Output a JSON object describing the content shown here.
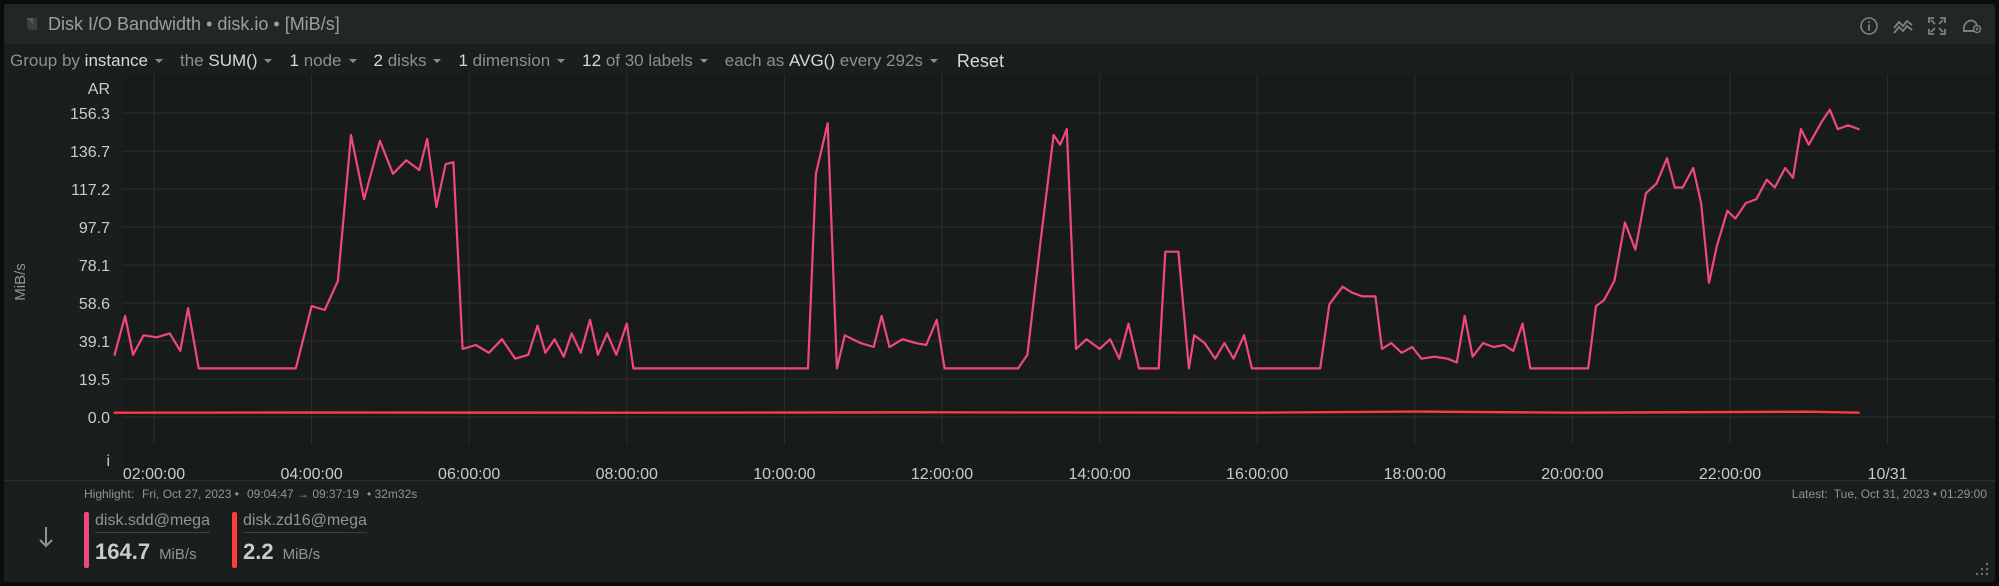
{
  "header": {
    "title": "Disk I/O Bandwidth • disk.io • [MiB/s]",
    "icons": [
      "info-icon",
      "correlate-icon",
      "fullscreen-icon",
      "alert-icon"
    ]
  },
  "filters": {
    "group_by_label": "Group by",
    "group_by_value": "instance",
    "the_label": "the",
    "aggregation": "SUM()",
    "nodes_count": "1",
    "nodes_label": "node",
    "disks_count": "2",
    "disks_label": "disks",
    "dimensions_count": "1",
    "dimensions_label": "dimension",
    "labels_count": "12",
    "labels_label": "of 30 labels",
    "each_as_label": "each as",
    "time_agg": "AVG()",
    "every_label": "every 292s",
    "reset_label": "Reset"
  },
  "chart": {
    "ar_label": "AR",
    "i_label": "i",
    "ylabel": "MiB/s",
    "yticks": [
      "156.3",
      "136.7",
      "117.2",
      "97.7",
      "78.1",
      "58.6",
      "39.1",
      "19.5",
      "0.0"
    ],
    "xticks": [
      "02:00:00",
      "04:00:00",
      "06:00:00",
      "08:00:00",
      "10:00:00",
      "12:00:00",
      "14:00:00",
      "16:00:00",
      "18:00:00",
      "20:00:00",
      "22:00:00",
      "10/31"
    ]
  },
  "chart_data": {
    "type": "line",
    "ylabel": "MiB/s",
    "ylim": [
      0,
      175.8
    ],
    "x_start": "01:30",
    "x_end": "11:29",
    "grid": true,
    "series": [
      {
        "name": "disk.sdd@mega",
        "color": "#f0487a",
        "points": [
          [
            "01:30",
            32
          ],
          [
            "01:38",
            52
          ],
          [
            "01:44",
            32
          ],
          [
            "01:52",
            42
          ],
          [
            "02:02",
            41
          ],
          [
            "02:12",
            43
          ],
          [
            "02:20",
            34
          ],
          [
            "02:26",
            56
          ],
          [
            "02:34",
            25
          ],
          [
            "02:50",
            25
          ],
          [
            "03:10",
            25
          ],
          [
            "03:30",
            25
          ],
          [
            "03:48",
            25
          ],
          [
            "04:00",
            57
          ],
          [
            "04:10",
            55
          ],
          [
            "04:20",
            70
          ],
          [
            "04:30",
            145
          ],
          [
            "04:40",
            112
          ],
          [
            "04:52",
            142
          ],
          [
            "05:02",
            125
          ],
          [
            "05:12",
            132
          ],
          [
            "05:22",
            127
          ],
          [
            "05:28",
            143
          ],
          [
            "05:35",
            108
          ],
          [
            "05:42",
            130
          ],
          [
            "05:48",
            131
          ],
          [
            "05:55",
            35
          ],
          [
            "06:05",
            37
          ],
          [
            "06:15",
            33
          ],
          [
            "06:25",
            40
          ],
          [
            "06:35",
            30
          ],
          [
            "06:45",
            32
          ],
          [
            "06:52",
            47
          ],
          [
            "06:58",
            33
          ],
          [
            "07:05",
            40
          ],
          [
            "07:12",
            31
          ],
          [
            "07:18",
            43
          ],
          [
            "07:25",
            33
          ],
          [
            "07:32",
            50
          ],
          [
            "07:38",
            32
          ],
          [
            "07:45",
            43
          ],
          [
            "07:52",
            32
          ],
          [
            "08:00",
            48
          ],
          [
            "08:05",
            25
          ],
          [
            "08:20",
            25
          ],
          [
            "08:40",
            25
          ],
          [
            "09:00",
            25
          ],
          [
            "09:20",
            25
          ],
          [
            "09:40",
            25
          ],
          [
            "10:00",
            25
          ],
          [
            "10:18",
            25
          ],
          [
            "10:24",
            125
          ],
          [
            "10:33",
            151
          ],
          [
            "10:40",
            25
          ],
          [
            "10:46",
            42
          ],
          [
            "10:58",
            38
          ],
          [
            "11:08",
            36
          ],
          [
            "11:14",
            52
          ],
          [
            "11:20",
            36
          ],
          [
            "11:30",
            40
          ],
          [
            "11:40",
            38
          ],
          [
            "11:48",
            37
          ],
          [
            "11:56",
            50
          ],
          [
            "12:02",
            25
          ],
          [
            "12:20",
            25
          ],
          [
            "12:40",
            25
          ],
          [
            "12:58",
            25
          ],
          [
            "13:05",
            32
          ],
          [
            "13:15",
            90
          ],
          [
            "13:25",
            145
          ],
          [
            "13:30",
            140
          ],
          [
            "13:35",
            148
          ],
          [
            "13:42",
            35
          ],
          [
            "13:50",
            40
          ],
          [
            "14:00",
            35
          ],
          [
            "14:08",
            40
          ],
          [
            "14:15",
            30
          ],
          [
            "14:22",
            48
          ],
          [
            "14:30",
            25
          ],
          [
            "14:45",
            25
          ],
          [
            "14:50",
            85
          ],
          [
            "15:00",
            85
          ],
          [
            "15:08",
            25
          ],
          [
            "15:12",
            42
          ],
          [
            "15:20",
            38
          ],
          [
            "15:28",
            30
          ],
          [
            "15:35",
            38
          ],
          [
            "15:42",
            30
          ],
          [
            "15:50",
            42
          ],
          [
            "15:56",
            25
          ],
          [
            "16:10",
            25
          ],
          [
            "16:30",
            25
          ],
          [
            "16:48",
            25
          ],
          [
            "16:55",
            58
          ],
          [
            "17:05",
            67
          ],
          [
            "17:12",
            64
          ],
          [
            "17:20",
            62
          ],
          [
            "17:30",
            62
          ],
          [
            "17:35",
            35
          ],
          [
            "17:42",
            38
          ],
          [
            "17:50",
            33
          ],
          [
            "17:58",
            36
          ],
          [
            "18:05",
            30
          ],
          [
            "18:15",
            31
          ],
          [
            "18:25",
            30
          ],
          [
            "18:32",
            28
          ],
          [
            "18:38",
            52
          ],
          [
            "18:44",
            31
          ],
          [
            "18:52",
            38
          ],
          [
            "19:00",
            36
          ],
          [
            "19:08",
            37
          ],
          [
            "19:15",
            34
          ],
          [
            "19:22",
            48
          ],
          [
            "19:28",
            25
          ],
          [
            "19:45",
            25
          ],
          [
            "20:00",
            25
          ],
          [
            "20:12",
            25
          ],
          [
            "20:18",
            57
          ],
          [
            "20:24",
            60
          ],
          [
            "20:32",
            70
          ],
          [
            "20:40",
            100
          ],
          [
            "20:48",
            86
          ],
          [
            "20:56",
            115
          ],
          [
            "21:04",
            120
          ],
          [
            "21:12",
            133
          ],
          [
            "21:18",
            118
          ],
          [
            "21:24",
            118
          ],
          [
            "21:32",
            128
          ],
          [
            "21:38",
            110
          ],
          [
            "21:44",
            69
          ],
          [
            "21:50",
            88
          ],
          [
            "21:58",
            106
          ],
          [
            "22:04",
            102
          ],
          [
            "22:12",
            110
          ],
          [
            "22:20",
            112
          ],
          [
            "22:28",
            122
          ],
          [
            "22:34",
            118
          ],
          [
            "22:42",
            128
          ],
          [
            "22:48",
            123
          ],
          [
            "22:54",
            148
          ],
          [
            "23:00",
            140
          ],
          [
            "23:10",
            152
          ],
          [
            "23:16",
            158
          ],
          [
            "23:22",
            148
          ],
          [
            "23:30",
            150
          ],
          [
            "23:38",
            148
          ]
        ]
      },
      {
        "name": "disk.zd16@mega",
        "color": "#ff3b3b",
        "points": [
          [
            "01:30",
            2.2
          ],
          [
            "04:00",
            2.3
          ],
          [
            "08:00",
            2.2
          ],
          [
            "12:00",
            2.4
          ],
          [
            "16:00",
            2.2
          ],
          [
            "18:00",
            2.8
          ],
          [
            "20:00",
            2.2
          ],
          [
            "23:00",
            2.7
          ],
          [
            "23:38",
            2.2
          ]
        ]
      }
    ]
  },
  "footer": {
    "highlight_label": "Highlight:",
    "highlight_date": "Fri, Oct 27, 2023 •",
    "highlight_range": "09:04:47 → 09:37:19",
    "highlight_duration": "• 32m32s",
    "latest_label": "Latest:",
    "latest_date": "Tue, Oct 31, 2023 • 01:29:00"
  },
  "legend": [
    {
      "name": "disk.sdd@mega",
      "value": "164.7",
      "unit": "MiB/s",
      "color": "#f0487a"
    },
    {
      "name": "disk.zd16@mega",
      "value": "2.2",
      "unit": "MiB/s",
      "color": "#ff3b3b"
    }
  ]
}
